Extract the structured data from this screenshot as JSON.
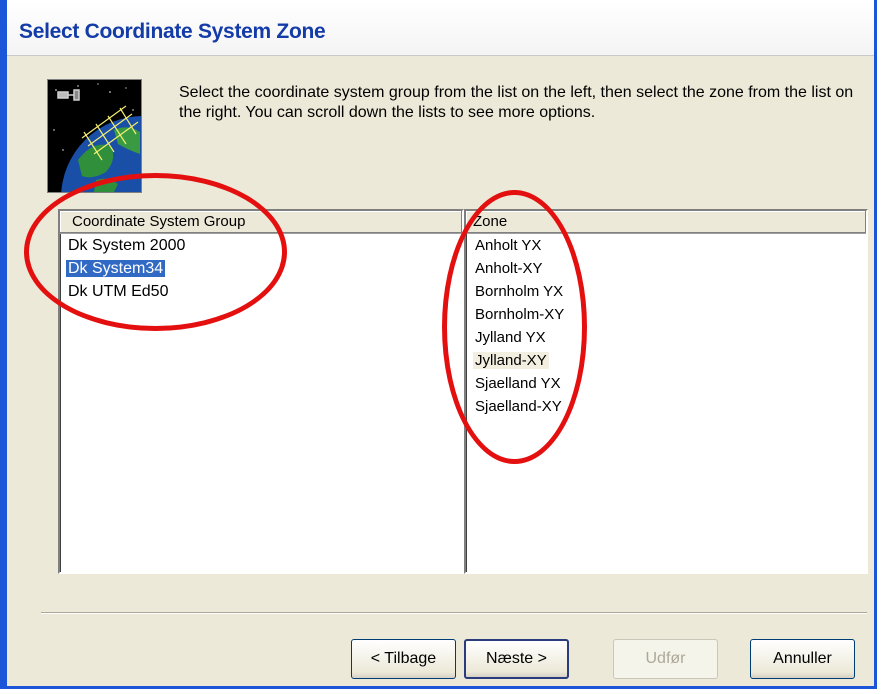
{
  "dialog": {
    "title": "Select Coordinate System Zone",
    "instructions": "Select the coordinate system group from the list on the left, then select the zone from the list on the right.  You can scroll down the lists to see more options.",
    "icon": "globe-satellite-icon"
  },
  "group_list": {
    "header": "Coordinate System Group",
    "items": [
      "Dk System 2000",
      "Dk System34",
      "Dk UTM Ed50"
    ],
    "selected": "Dk System34"
  },
  "zone_list": {
    "header": "Zone",
    "items": [
      "Anholt YX",
      "Anholt-XY",
      "Bornholm YX",
      "Bornholm-XY",
      "Jylland YX",
      "Jylland-XY",
      "Sjaelland YX",
      "Sjaelland-XY"
    ],
    "focused": "Jylland-XY"
  },
  "buttons": {
    "back": "< Tilbage",
    "next": "Næste >",
    "finish": "Udfør",
    "cancel": "Annuller"
  },
  "colors": {
    "title_text": "#143ca8",
    "window_frame": "#1c56d8",
    "selection": "#316ac5",
    "annotation": "#e41010"
  }
}
